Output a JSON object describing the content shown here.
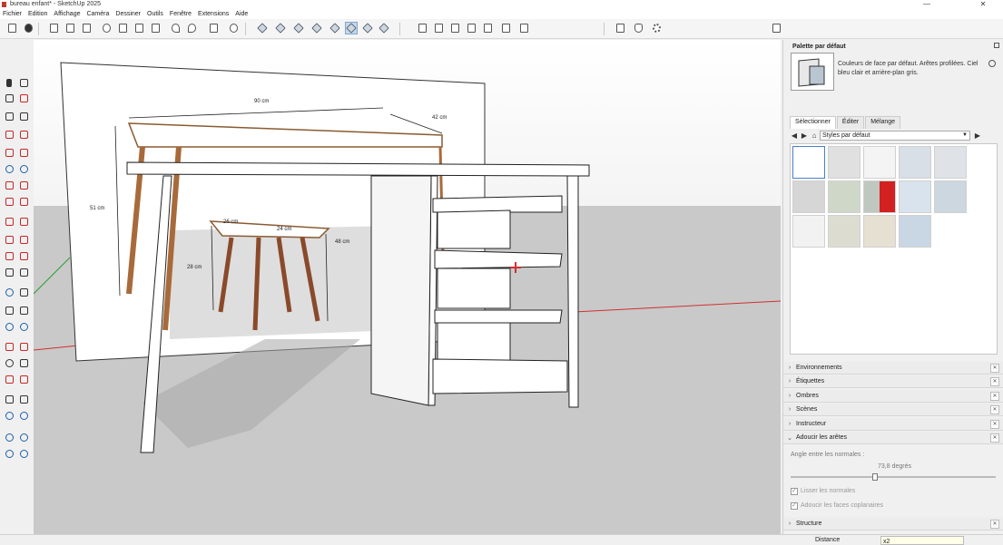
{
  "app": {
    "title": "bureau enfant* - SketchUp 2025",
    "minimize": "—",
    "close": "✕"
  },
  "menu": [
    "Fichier",
    "Edition",
    "Affichage",
    "Caméra",
    "Dessiner",
    "Outils",
    "Fenêtre",
    "Extensions",
    "Aide"
  ],
  "scene": {
    "dimensions": {
      "width": "90 cm",
      "depth": "42 cm",
      "height": "51 cm",
      "stool_depth": "26 cm",
      "stool_width": "24 cm",
      "stool_height": "28 cm",
      "drawer_height": "48 cm"
    }
  },
  "panel": {
    "title": "Palette par défaut",
    "style_description": "Couleurs de face par défaut. Arêtes profilées. Ciel bleu clair et arrière-plan gris.",
    "tabs": [
      "Sélectionner",
      "Éditer",
      "Mélange"
    ],
    "collection": "Styles par défaut",
    "sections": [
      "Environnements",
      "Étiquettes",
      "Ombres",
      "Scènes",
      "Instructeur",
      "Adoucir les arêtes"
    ],
    "soften": {
      "angle_label": "Angle entre les normales :",
      "angle_value": "73,8  degrés",
      "angle_fraction": 0.41,
      "smooth_normals": "Lisser les normales",
      "soften_coplanar": "Adoucir les faces coplanaires"
    },
    "last_section": "Structure"
  },
  "status": {
    "distance_label": "Distance",
    "distance_value": "x2"
  },
  "colors": {
    "accent": "#7fa6cf",
    "ground": "#c9c9c9",
    "red_axis": "#d03030",
    "green_axis": "#2e9b2e"
  }
}
